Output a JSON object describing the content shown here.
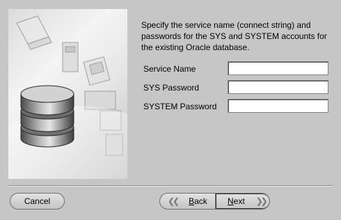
{
  "description": {
    "line1": "Specify the service name (connect string) and",
    "line2": "passwords for the SYS and SYSTEM accounts for",
    "line3": "the existing Oracle database."
  },
  "fields": {
    "service_name": {
      "label": "Service Name",
      "value": ""
    },
    "sys_password": {
      "label": "SYS Password",
      "value": ""
    },
    "system_password": {
      "label": "SYSTEM Password",
      "value": ""
    }
  },
  "buttons": {
    "cancel": "Cancel",
    "back_mnemonic": "B",
    "back_rest": "ack",
    "next_mnemonic": "N",
    "next_rest": "ext"
  },
  "icons": {
    "back": "chevron-left-double-icon",
    "next": "chevron-right-double-icon"
  },
  "colors": {
    "background": "#c6c6c6",
    "input_bg": "#ffffff"
  }
}
